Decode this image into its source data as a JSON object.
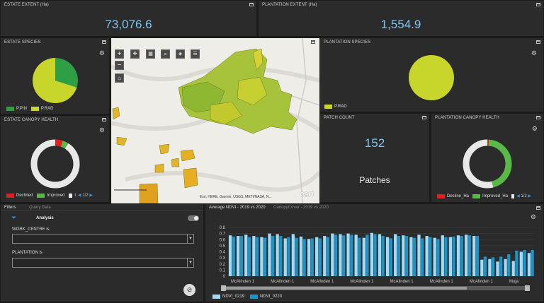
{
  "estate_extent": {
    "title": "ESTATE EXTENT (Ha)",
    "value": "73,076.6"
  },
  "plantation_extent": {
    "title": "PLANTATION EXTENT (Ha)",
    "value": "1,554.9"
  },
  "estate_species": {
    "title": "ESTATE SPECIES",
    "legend": [
      {
        "label": "P.PIN",
        "color": "#2e9e44"
      },
      {
        "label": "P.RAD",
        "color": "#c8d52a"
      }
    ],
    "slices": [
      {
        "label": "P.PIN",
        "fraction": 0.3,
        "color": "#2e9e44"
      },
      {
        "label": "P.RAD",
        "fraction": 0.7,
        "color": "#c8d52a"
      }
    ]
  },
  "plantation_species": {
    "title": "PLANTATION SPECIES",
    "legend": [
      {
        "label": "P.RAD",
        "color": "#c8d52a"
      }
    ],
    "slices": [
      {
        "label": "P.RAD",
        "fraction": 1.0,
        "color": "#c8d52a"
      }
    ]
  },
  "estate_canopy": {
    "title": "ESTATE CANOPY HEALTH",
    "legend": [
      {
        "label": "Declined",
        "color": "#e02020"
      },
      {
        "label": "Improved",
        "color": "#58b848"
      },
      {
        "label": "I",
        "color": "#e8e8e8"
      }
    ],
    "pager": "1/2",
    "slices": [
      {
        "label": "Declined",
        "fraction": 0.05,
        "color": "#e02020"
      },
      {
        "label": "Improved",
        "fraction": 0.04,
        "color": "#58b848"
      },
      {
        "label": "I",
        "fraction": 0.91,
        "color": "#e8e8e8"
      }
    ]
  },
  "patch_count": {
    "title": "PATCH COUNT",
    "value": "152",
    "label": "Patches"
  },
  "plantation_canopy": {
    "title": "PLANTATION CANOPY HEALTH",
    "legend": [
      {
        "label": "Decline_Ha",
        "color": "#e02020"
      },
      {
        "label": "Improved_Ha",
        "color": "#58b848"
      },
      {
        "label": "",
        "color": "#e8e8e8"
      }
    ],
    "pager": "1/2",
    "slices": [
      {
        "label": "Decline_Ha",
        "fraction": 0.01,
        "color": "#e02020"
      },
      {
        "label": "Improved_Ha",
        "fraction": 0.45,
        "color": "#58b848"
      },
      {
        "label": "",
        "fraction": 0.54,
        "color": "#e8e8e8"
      }
    ]
  },
  "map": {
    "attribution": "Esri, HERE, Garmin, USGS, METI/NASA, N...",
    "logo": "esri"
  },
  "filters": {
    "tabs": [
      "Filters",
      "Query Data"
    ],
    "analysis_label": "Analysis",
    "work_centre_label": "WORK_CENTRE is",
    "plantation_label": "PLANTATION is"
  },
  "ndvi_tabs": [
    "Average NDVI - 2019 vs 2020",
    "CanopyCover - 2019 vs 2020"
  ],
  "chart_data": {
    "type": "bar",
    "yticks": [
      "0.8",
      "0.7",
      "0.6",
      "0.5",
      "0.4",
      "0.3",
      "0.2",
      "0.1",
      "0"
    ],
    "ylim": [
      0,
      0.8
    ],
    "xlabels": [
      "McAlinden 1",
      "McAlinden 1",
      "McAlinden 1",
      "McAlinden 1",
      "McAlinden 1",
      "McAlinden 1",
      "McAlinden 1",
      "Muja"
    ],
    "series": [
      {
        "name": "NDVI_0219",
        "color": "#a6daf4",
        "values": [
          0.67,
          0.66,
          0.68,
          0.66,
          0.64,
          0.7,
          0.69,
          0.62,
          0.69,
          0.65,
          0.61,
          0.64,
          0.66,
          0.7,
          0.69,
          0.7,
          0.68,
          0.63,
          0.71,
          0.69,
          0.64,
          0.69,
          0.67,
          0.64,
          0.68,
          0.66,
          0.63,
          0.67,
          0.64,
          0.67,
          0.68,
          0.66,
          0.27,
          0.28,
          0.24,
          0.28,
          0.25,
          0.4,
          0.38
        ]
      },
      {
        "name": "NDVI_0220",
        "color": "#1c94c6",
        "values": [
          0.65,
          0.66,
          0.64,
          0.64,
          0.63,
          0.66,
          0.66,
          0.64,
          0.63,
          0.61,
          0.62,
          0.62,
          0.64,
          0.68,
          0.67,
          0.68,
          0.63,
          0.68,
          0.69,
          0.66,
          0.62,
          0.66,
          0.66,
          0.63,
          0.62,
          0.64,
          0.61,
          0.64,
          0.65,
          0.66,
          0.67,
          0.66,
          0.32,
          0.31,
          0.32,
          0.36,
          0.42,
          0.43,
          0.43
        ]
      }
    ]
  }
}
